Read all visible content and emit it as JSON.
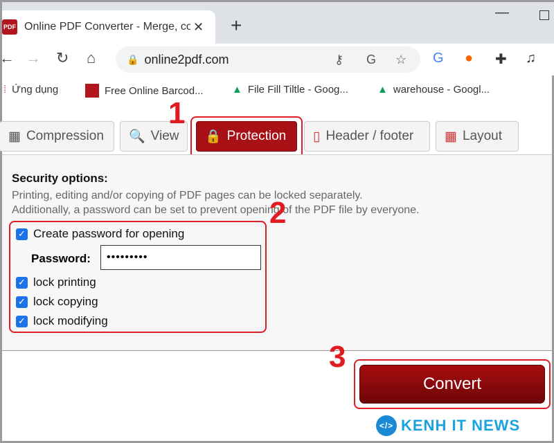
{
  "browser": {
    "tab_title": "Online PDF Converter - Merge, co",
    "favicon": "PDF",
    "url": "online2pdf.com",
    "bookmarks": [
      {
        "label": "Ứng dụng",
        "icon": "apps-icon"
      },
      {
        "label": "Free Online Barcod...",
        "icon": "barcode-icon"
      },
      {
        "label": "File Fill Tiltle - Goog...",
        "icon": "drive-icon"
      },
      {
        "label": "warehouse - Googl...",
        "icon": "drive-icon"
      }
    ]
  },
  "tabs": [
    {
      "label": "Compression"
    },
    {
      "label": "View"
    },
    {
      "label": "Protection",
      "active": true
    },
    {
      "label": "Header / footer"
    },
    {
      "label": "Layout"
    }
  ],
  "security": {
    "title": "Security options:",
    "desc1": "Printing, editing and/or copying of PDF pages can be locked separately.",
    "desc2": "Additionally, a password can be set to prevent opening of the PDF file by everyone.",
    "create_password": {
      "label": "Create password for opening",
      "checked": true
    },
    "password_label": "Password:",
    "password_value": "•••••••••",
    "locks": [
      {
        "label": "lock printing",
        "checked": true
      },
      {
        "label": "lock copying",
        "checked": true
      },
      {
        "label": "lock modifying",
        "checked": true
      }
    ]
  },
  "convert_label": "Convert",
  "annotations": [
    "1",
    "2",
    "3"
  ],
  "watermark": "KENH IT NEWS",
  "colors": {
    "accent": "#a71115",
    "highlight": "#e01b22",
    "checkbox": "#1a73e8"
  }
}
